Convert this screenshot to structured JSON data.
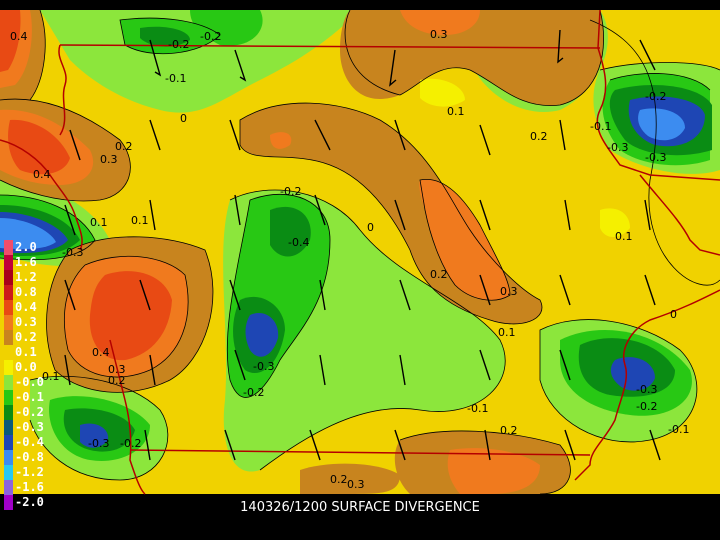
{
  "title": "140326/1200 SURFACE DIVERGENCE",
  "legend": [
    {
      "label": "2.0",
      "color": "#f04d6b"
    },
    {
      "label": "1.6",
      "color": "#c0003a"
    },
    {
      "label": "1.2",
      "color": "#a8001a"
    },
    {
      "label": "0.8",
      "color": "#cc1a1a"
    },
    {
      "label": "0.4",
      "color": "#e84a14"
    },
    {
      "label": "0.3",
      "color": "#f07a1e"
    },
    {
      "label": "0.2",
      "color": "#c8841e"
    },
    {
      "label": "0.1",
      "color": "#f0d200"
    },
    {
      "label": "0.0",
      "color": "#f5f000"
    },
    {
      "label": "-0.0",
      "color": "#8ce63c"
    },
    {
      "label": "-0.1",
      "color": "#28c814"
    },
    {
      "label": "-0.2",
      "color": "#0a8c14"
    },
    {
      "label": "-0.3",
      "color": "#0a5a7a"
    },
    {
      "label": "-0.4",
      "color": "#1e46b4"
    },
    {
      "label": "-0.8",
      "color": "#3c8cf0"
    },
    {
      "label": "-1.2",
      "color": "#28c8f0"
    },
    {
      "label": "-1.6",
      "color": "#8c64dc"
    },
    {
      "label": "-2.0",
      "color": "#a000c8"
    }
  ],
  "contour_labels": [
    "0.4",
    "-0.2",
    "-0.2",
    "0.3",
    "-0.1",
    "0",
    "0.1",
    "0.2",
    "0.2",
    "0.3",
    "0.4",
    "-0.2",
    "-0.1",
    "0.1",
    "-0.3",
    "-0.3",
    "-0.2",
    "0.2",
    "0.3",
    "0",
    "0.1",
    "-0.4",
    "-0.3",
    "0.1",
    "0",
    "0.4",
    "0.3",
    "0.1",
    "0.2",
    "-0.3",
    "-0.2",
    "-0.3",
    "-0.2",
    "-0.1",
    "-0.1",
    "0.2",
    "-0.3",
    "-0.2",
    "0.1",
    "0.2",
    "0.3"
  ]
}
